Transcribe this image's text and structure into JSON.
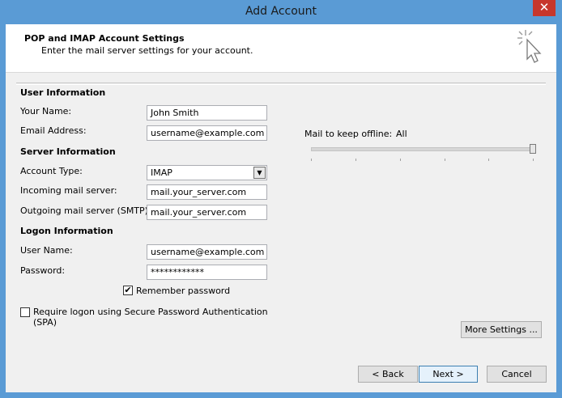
{
  "window": {
    "title": "Add Account",
    "close_glyph": "✕"
  },
  "header": {
    "title": "POP and IMAP Account Settings",
    "subtitle": "Enter the mail server settings for your account.",
    "icon": "cursor-sparkle-icon"
  },
  "user_info": {
    "heading": "User Information",
    "name_label": "Your Name:",
    "name_value": "John Smith",
    "email_label": "Email Address:",
    "email_value": "username@example.com"
  },
  "server_info": {
    "heading": "Server Information",
    "account_type_label": "Account Type:",
    "account_type_value": "IMAP",
    "incoming_label": "Incoming mail server:",
    "incoming_value": "mail.your_server.com",
    "outgoing_label": "Outgoing mail server (SMTP):",
    "outgoing_value": "mail.your_server.com"
  },
  "logon_info": {
    "heading": "Logon Information",
    "username_label": "User Name:",
    "username_value": "username@example.com",
    "password_label": "Password:",
    "password_value": "************",
    "remember_label": "Remember password",
    "remember_checked": true,
    "spa_label_line1": "Require logon using Secure Password Authentication",
    "spa_label_line2": "(SPA)",
    "spa_checked": false
  },
  "offline": {
    "label": "Mail to keep offline:",
    "value": "All",
    "slider_level": 1.0
  },
  "buttons": {
    "more_settings": "More Settings ...",
    "back": "< Back",
    "next": "Next >",
    "cancel": "Cancel"
  },
  "check_glyph": "✔"
}
